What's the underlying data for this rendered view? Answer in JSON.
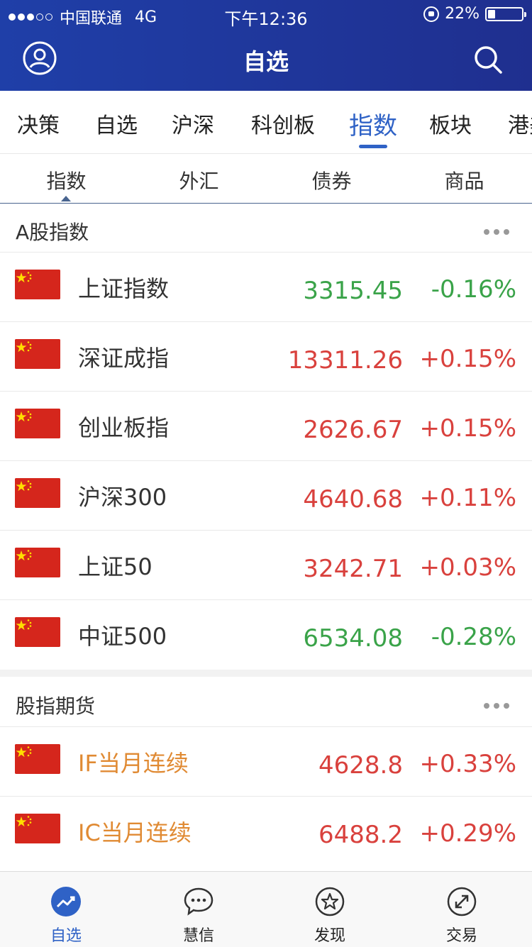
{
  "status_bar": {
    "carrier": "中国联通",
    "network": "4G",
    "time": "下午12:36",
    "battery_text": "22%",
    "battery_level": 0.22
  },
  "header": {
    "title": "自选",
    "left_icon": "user-icon",
    "right_icon": "search-icon"
  },
  "top_tabs": [
    "决策",
    "自选",
    "沪深",
    "科创板",
    "指数",
    "板块",
    "港美"
  ],
  "top_tab_active": "指数",
  "sub_tabs": [
    "指数",
    "外汇",
    "债券",
    "商品"
  ],
  "sub_tab_active": "指数",
  "sections": [
    {
      "title": "A股指数",
      "rows": [
        {
          "name": "上证指数",
          "price": "3315.45",
          "change": "-0.16%",
          "trend": "down"
        },
        {
          "name": "深证成指",
          "price": "13311.26",
          "change": "+0.15%",
          "trend": "up"
        },
        {
          "name": "创业板指",
          "price": "2626.67",
          "change": "+0.15%",
          "trend": "up"
        },
        {
          "name": "沪深300",
          "price": "4640.68",
          "change": "+0.11%",
          "trend": "up"
        },
        {
          "name": "上证50",
          "price": "3242.71",
          "change": "+0.03%",
          "trend": "up"
        },
        {
          "name": "中证500",
          "price": "6534.08",
          "change": "-0.28%",
          "trend": "down"
        }
      ]
    },
    {
      "title": "股指期货",
      "rows": [
        {
          "name": "IF当月连续",
          "price": "4628.8",
          "change": "+0.33%",
          "trend": "up"
        },
        {
          "name": "IC当月连续",
          "price": "6488.2",
          "change": "+0.29%",
          "trend": "up"
        }
      ]
    }
  ],
  "bottom_nav": [
    {
      "label": "自选",
      "icon": "trend-chart-icon",
      "active": true
    },
    {
      "label": "慧信",
      "icon": "chat-bubble-icon",
      "active": false
    },
    {
      "label": "发现",
      "icon": "star-badge-icon",
      "active": false
    },
    {
      "label": "交易",
      "icon": "exchange-icon",
      "active": false
    }
  ],
  "colors": {
    "header_bg": "#1f3fa8",
    "accent": "#2f62c6",
    "up": "#d9413d",
    "down": "#3aa349",
    "futures_name": "#e08a33"
  }
}
